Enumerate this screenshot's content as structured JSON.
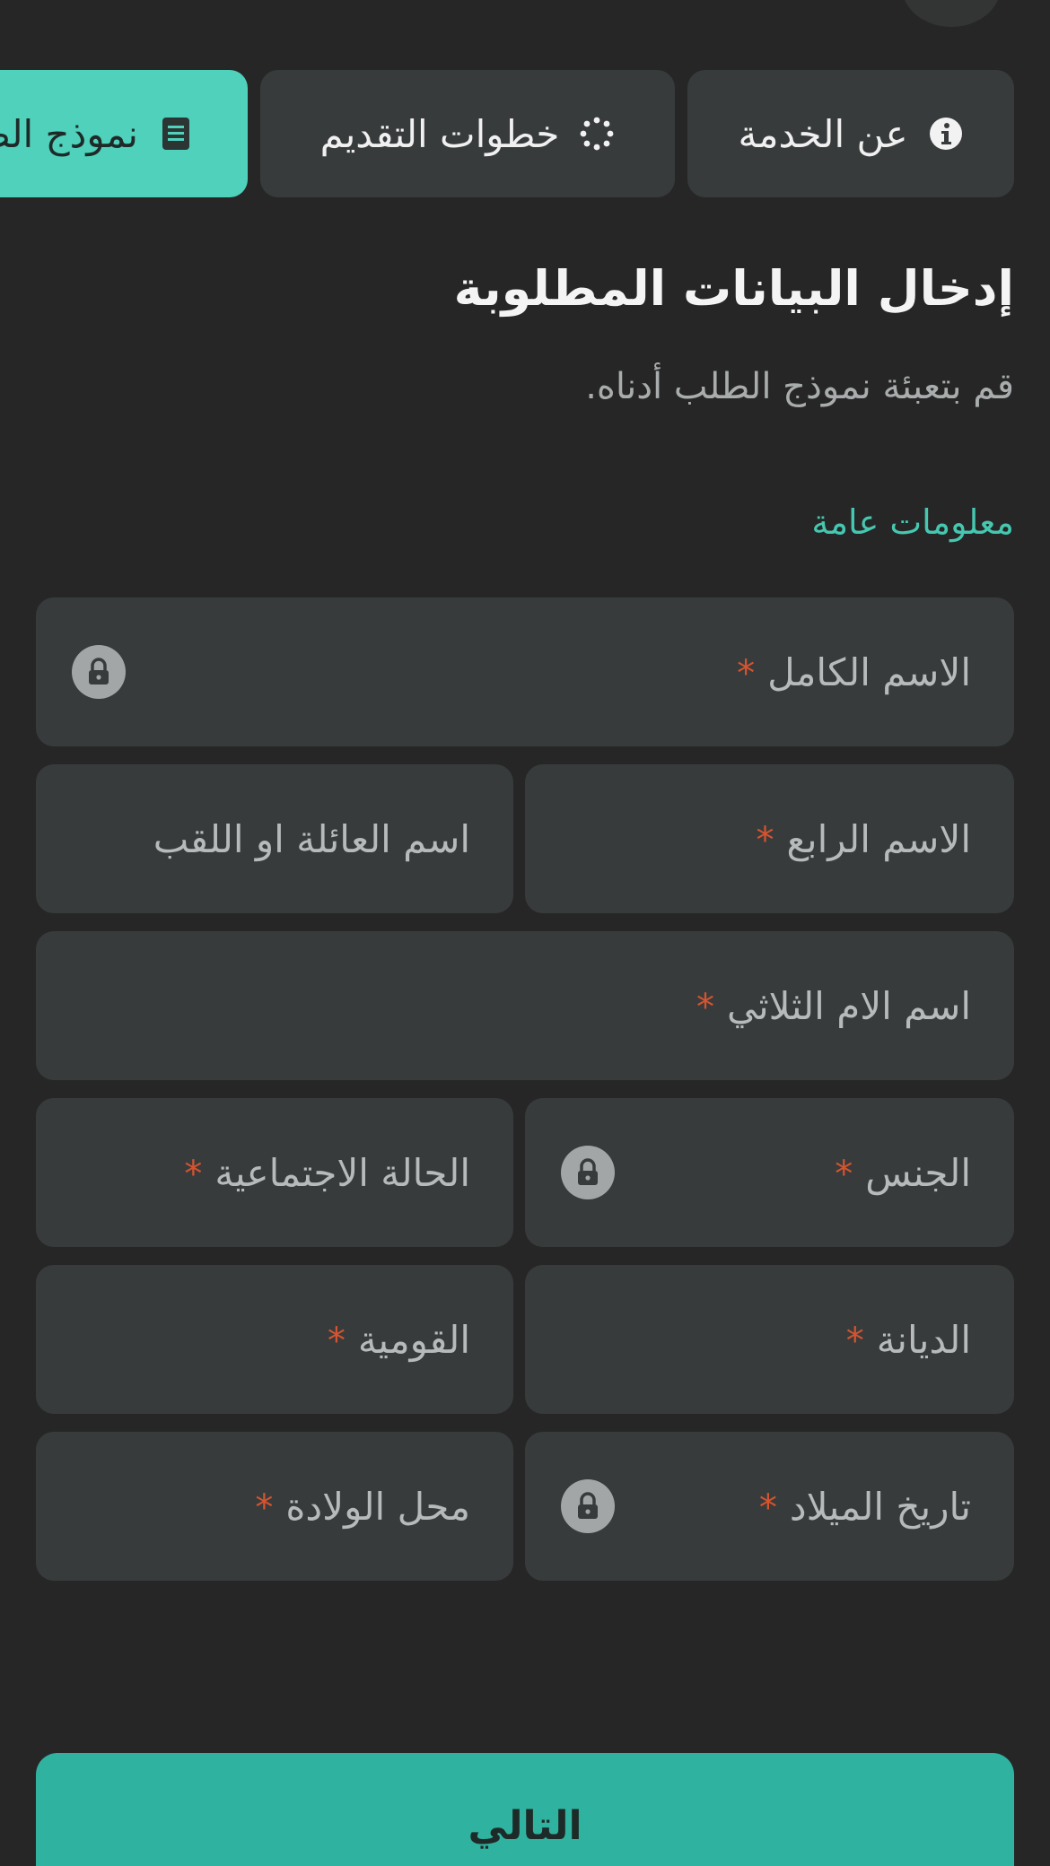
{
  "tabs": [
    {
      "label": "عن الخدمة",
      "icon": "info-icon",
      "active": false
    },
    {
      "label": "خطوات التقديم",
      "icon": "refresh-steps-icon",
      "active": false
    },
    {
      "label": "نموذج الطلب",
      "icon": "document-icon",
      "active": true
    }
  ],
  "header": {
    "title": "إدخال البيانات المطلوبة",
    "subtitle": "قم بتعبئة نموذج الطلب أدناه."
  },
  "section": {
    "title": "معلومات عامة"
  },
  "fields": {
    "full_name": {
      "label": "الاسم الكامل",
      "required": "*",
      "locked": true
    },
    "fourth_name": {
      "label": "الاسم الرابع",
      "required": "*",
      "locked": false
    },
    "family_name": {
      "label": "اسم العائلة او اللقب",
      "required": "",
      "locked": false
    },
    "mother_name": {
      "label": "اسم الام الثلاثي",
      "required": "*",
      "locked": false
    },
    "gender": {
      "label": "الجنس",
      "required": "*",
      "locked": true
    },
    "marital_status": {
      "label": "الحالة الاجتماعية",
      "required": "*",
      "locked": false
    },
    "religion": {
      "label": "الديانة",
      "required": "*",
      "locked": false
    },
    "nationality": {
      "label": "القومية",
      "required": "*",
      "locked": false
    },
    "birth_date": {
      "label": "تاريخ الميلاد",
      "required": "*",
      "locked": true
    },
    "birth_place": {
      "label": "محل الولادة",
      "required": "*",
      "locked": false
    }
  },
  "actions": {
    "next_label": "التالي"
  },
  "colors": {
    "background": "#262626",
    "surface": "#383b3c",
    "accent": "#4fd1bb",
    "button": "#2fb3a0",
    "required": "#d4542f"
  }
}
